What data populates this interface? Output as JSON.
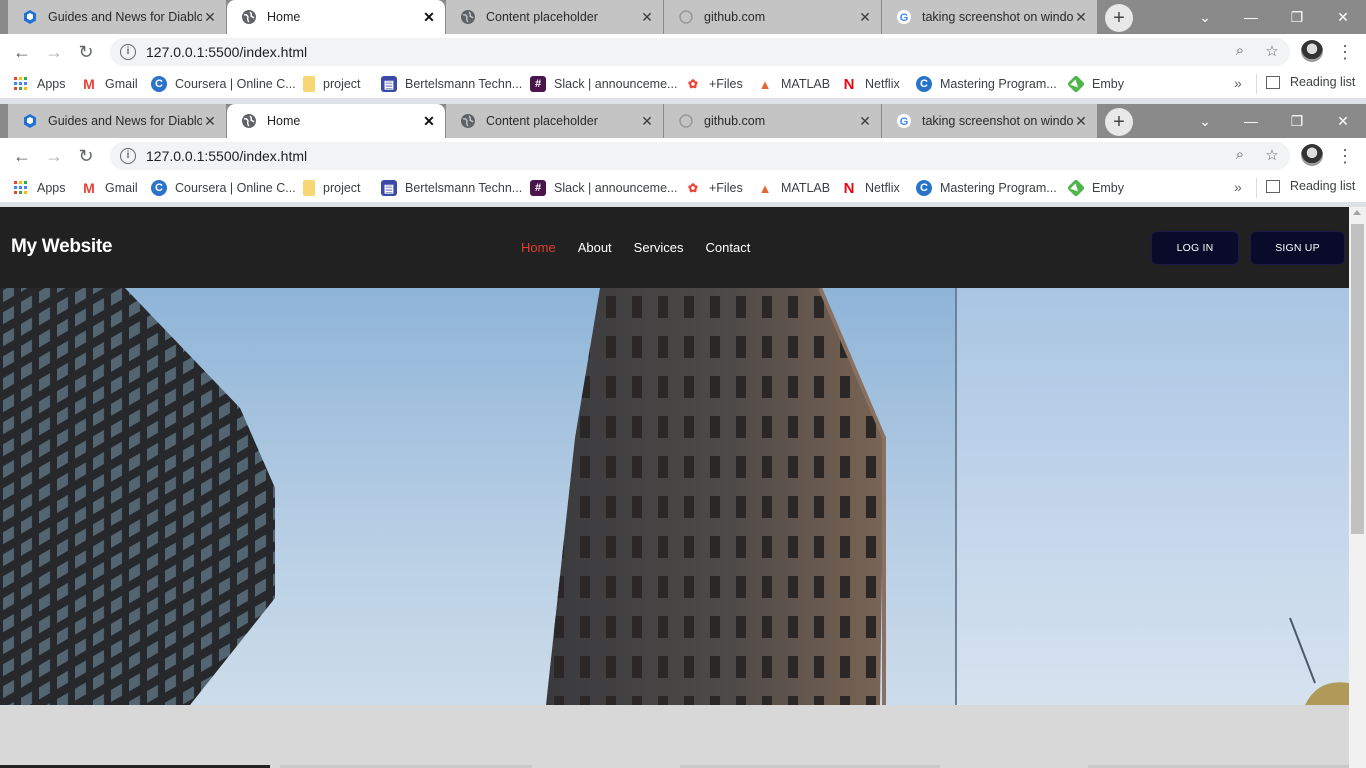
{
  "browser": {
    "tabs": [
      {
        "title": "Guides and News for Diablo",
        "icon": "diablo-cube-icon",
        "active": false
      },
      {
        "title": "Home",
        "icon": "globe-icon",
        "active": true
      },
      {
        "title": "Content placeholder",
        "icon": "globe-icon",
        "active": false
      },
      {
        "title": "github.com",
        "icon": "loading-icon",
        "active": false
      },
      {
        "title": "taking screenshot on window",
        "icon": "google-icon",
        "active": false
      }
    ],
    "url": "127.0.0.1:5500/index.html",
    "bookmarks": [
      {
        "label": "Apps",
        "icon": "apps-grid-icon"
      },
      {
        "label": "Gmail",
        "icon": "gmail-icon"
      },
      {
        "label": "Coursera | Online C...",
        "icon": "coursera-icon"
      },
      {
        "label": "project",
        "icon": "folder-icon"
      },
      {
        "label": "Bertelsmann Techn...",
        "icon": "bertelsmann-icon"
      },
      {
        "label": "Slack | announceme...",
        "icon": "slack-icon"
      },
      {
        "label": "+Files",
        "icon": "files-icon"
      },
      {
        "label": "MATLAB",
        "icon": "matlab-icon"
      },
      {
        "label": "Netflix",
        "icon": "netflix-icon"
      },
      {
        "label": "Mastering Program...",
        "icon": "coursera-icon"
      },
      {
        "label": "Emby",
        "icon": "emby-icon"
      }
    ],
    "reading_list": "Reading list",
    "colors": {
      "tabstrip": "#8a8a8a",
      "inactive_tab": "#c4c4c4",
      "active_tab": "#ffffff"
    }
  },
  "site": {
    "logo": "My Website",
    "nav": [
      {
        "label": "Home",
        "active": true
      },
      {
        "label": "About",
        "active": false
      },
      {
        "label": "Services",
        "active": false
      },
      {
        "label": "Contact",
        "active": false
      }
    ],
    "login_label": "LOG IN",
    "signup_label": "SIGN UP",
    "colors": {
      "header_bg": "#212121",
      "active_link": "#e03e2f",
      "button_bg": "#0a0a2b"
    }
  }
}
